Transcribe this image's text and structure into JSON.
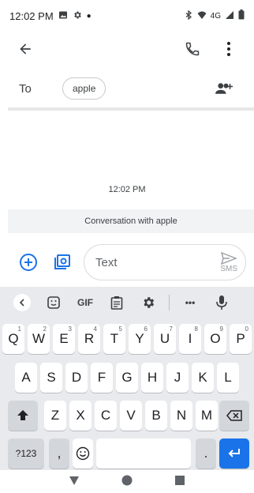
{
  "status_bar": {
    "time": "12:02 PM",
    "network": "4G"
  },
  "to_row": {
    "label": "To",
    "recipient_chip": "apple"
  },
  "conversation": {
    "timestamp": "12:02 PM",
    "banner": "Conversation with apple"
  },
  "compose": {
    "placeholder": "Text",
    "send_label": "SMS"
  },
  "keyboard": {
    "toolbar": {
      "gif": "GIF",
      "more": "•••"
    },
    "row1": [
      {
        "k": "Q",
        "h": "1"
      },
      {
        "k": "W",
        "h": "2"
      },
      {
        "k": "E",
        "h": "3"
      },
      {
        "k": "R",
        "h": "4"
      },
      {
        "k": "T",
        "h": "5"
      },
      {
        "k": "Y",
        "h": "6"
      },
      {
        "k": "U",
        "h": "7"
      },
      {
        "k": "I",
        "h": "8"
      },
      {
        "k": "O",
        "h": "9"
      },
      {
        "k": "P",
        "h": "0"
      }
    ],
    "row2": [
      "A",
      "S",
      "D",
      "F",
      "G",
      "H",
      "J",
      "K",
      "L"
    ],
    "row3": [
      "Z",
      "X",
      "C",
      "V",
      "B",
      "N",
      "M"
    ],
    "symbols": "?123",
    "comma": ",",
    "period": "."
  },
  "colors": {
    "accent": "#1a73e8",
    "keyboard_bg": "#e8eaed"
  }
}
